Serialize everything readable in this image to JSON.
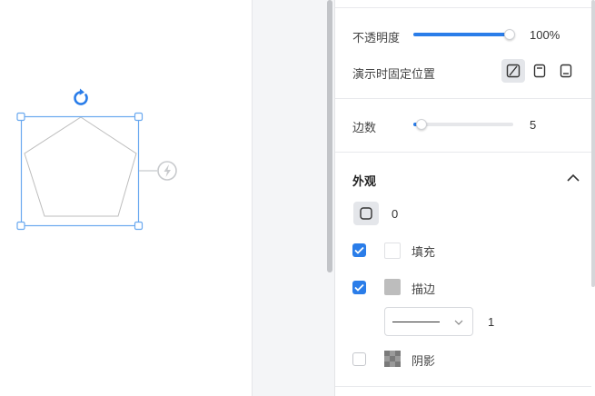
{
  "panel": {
    "opacity": {
      "label": "不透明度",
      "value": "100%",
      "level": 1.0
    },
    "fixed_position": {
      "label": "演示时固定位置",
      "options": [
        "not-fixed-icon",
        "fix-top-icon",
        "fix-bottom-icon"
      ],
      "active_index": 0
    },
    "sides": {
      "label": "边数",
      "value": "5",
      "level": 0.08
    },
    "appearance": {
      "title": "外观",
      "corner_radius": "0",
      "fill": {
        "label": "填充",
        "checked": true,
        "color": "#ffffff"
      },
      "stroke": {
        "label": "描边",
        "checked": true,
        "color": "#bdbdbd",
        "width": "1"
      },
      "shadow": {
        "label": "阴影",
        "checked": false
      }
    }
  },
  "colors": {
    "accent": "#2a7de9",
    "selection": "#6aa9ef"
  }
}
